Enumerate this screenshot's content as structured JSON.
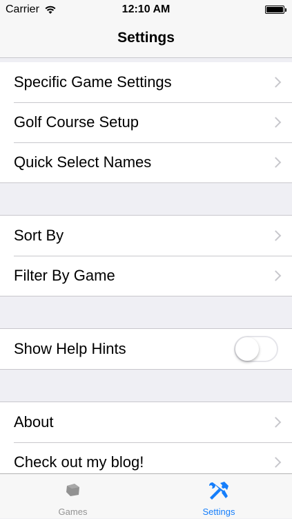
{
  "status_bar": {
    "carrier": "Carrier",
    "time": "12:10 AM"
  },
  "nav": {
    "title": "Settings"
  },
  "groups": [
    {
      "rows": [
        {
          "label": "Specific Game Settings"
        },
        {
          "label": "Golf Course Setup"
        },
        {
          "label": "Quick Select Names"
        }
      ]
    },
    {
      "rows": [
        {
          "label": "Sort By"
        },
        {
          "label": "Filter By Game"
        }
      ]
    },
    {
      "rows": [
        {
          "label": "Show Help Hints",
          "toggle_on": false
        }
      ]
    },
    {
      "rows": [
        {
          "label": "About"
        },
        {
          "label": "Check out my blog!"
        }
      ]
    }
  ],
  "tabs": [
    {
      "label": "Games",
      "icon": "games-icon",
      "selected": false
    },
    {
      "label": "Settings",
      "icon": "tools-icon",
      "selected": true
    }
  ],
  "colors": {
    "accent": "#157efb",
    "inactive_tab": "#929292",
    "separator": "#c8c7cc",
    "background": "#efeff4"
  }
}
